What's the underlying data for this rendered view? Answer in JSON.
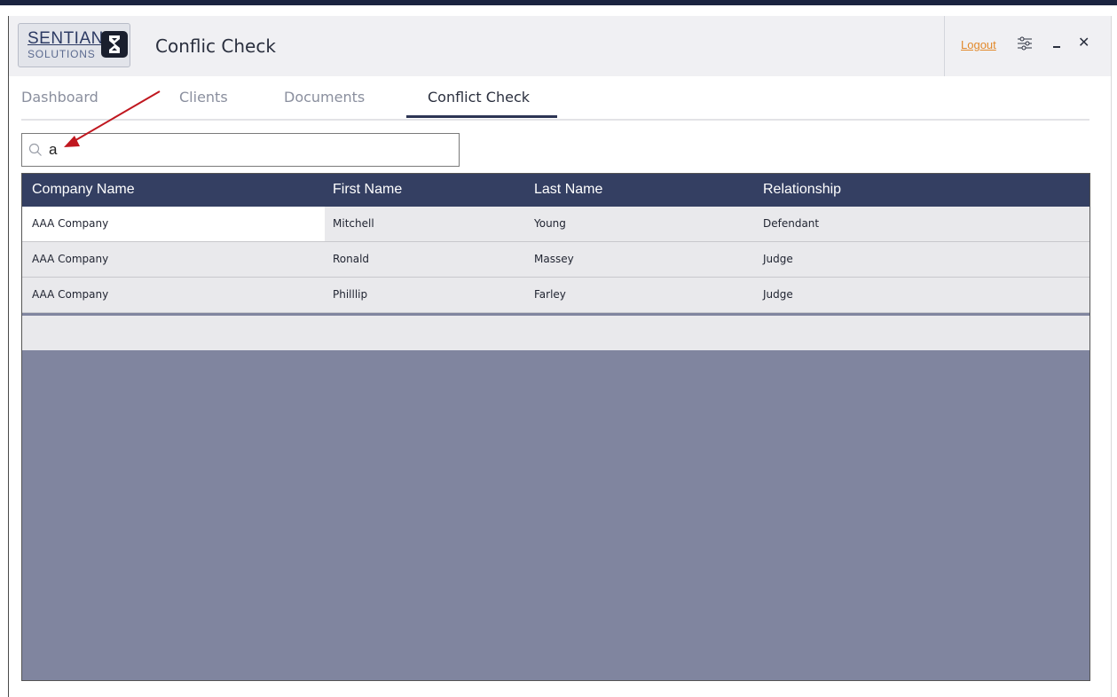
{
  "app": {
    "logo_line1": "SENTIAN",
    "logo_line2": "SOLUTIONS",
    "title": "Conflic Check"
  },
  "window_controls": {
    "logout_label": "Logout",
    "close_glyph": "✕"
  },
  "tabs": [
    {
      "label": "Dashboard",
      "active": false
    },
    {
      "label": "Clients",
      "active": false
    },
    {
      "label": "Documents",
      "active": false
    },
    {
      "label": "Conflict Check",
      "active": true
    }
  ],
  "search": {
    "value": "a",
    "icon": "search-icon"
  },
  "table": {
    "columns": [
      "Company Name",
      "First Name",
      "Last Name",
      "Relationship"
    ],
    "rows": [
      [
        "AAA Company",
        "Mitchell",
        "Young",
        "Defendant"
      ],
      [
        "AAA Company",
        "Ronald",
        "Massey",
        "Judge"
      ],
      [
        "AAA Company",
        "Philllip",
        "Farley",
        "Judge"
      ]
    ]
  },
  "colors": {
    "header_bg": "#343f62",
    "grid_empty_bg": "#80859f",
    "accent_link": "#e2892b",
    "annotation_arrow": "#c0171f"
  }
}
